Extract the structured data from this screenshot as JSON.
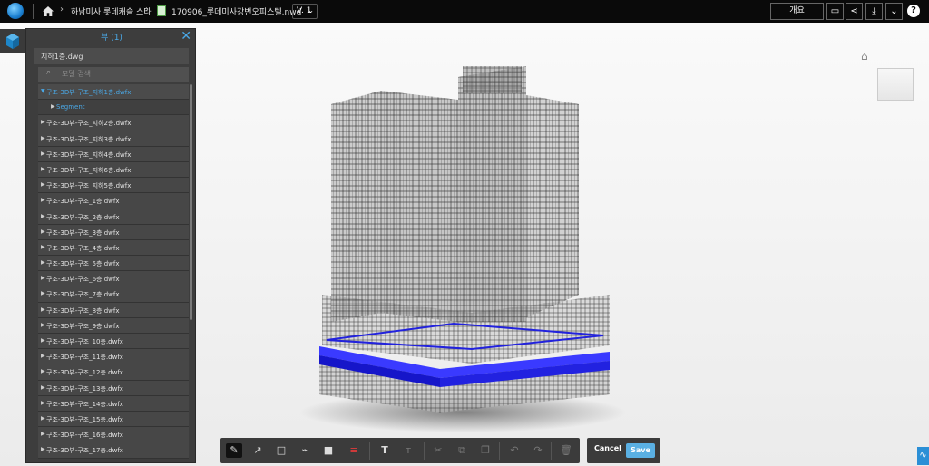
{
  "header": {
    "breadcrumb_project": "하남미사 롯데캐슬 스타",
    "file_name": "170906_롯데미사강변오피스텔.nwd",
    "version": "V. 1",
    "overview_label": "개요",
    "help_label": "?"
  },
  "panel": {
    "title": "뷰 (1)",
    "file_label": "지하1층.dwg",
    "search_placeholder": "모델 검색",
    "tree": [
      {
        "label": "구조-3D뷰-구조_지하1층.dwfx",
        "state": "expanded",
        "level": 0
      },
      {
        "label": "Segment",
        "state": "collapsed",
        "level": 1
      },
      {
        "label": "구조-3D뷰-구조_지하2층.dwfx",
        "state": "collapsed",
        "level": 0
      },
      {
        "label": "구조-3D뷰-구조_지하3층.dwfx",
        "state": "collapsed",
        "level": 0
      },
      {
        "label": "구조-3D뷰-구조_지하4층.dwfx",
        "state": "collapsed",
        "level": 0
      },
      {
        "label": "구조-3D뷰-구조_지하6층.dwfx",
        "state": "collapsed",
        "level": 0
      },
      {
        "label": "구조-3D뷰-구조_지하5층.dwfx",
        "state": "collapsed",
        "level": 0
      },
      {
        "label": "구조-3D뷰-구조_1층.dwfx",
        "state": "collapsed",
        "level": 0
      },
      {
        "label": "구조-3D뷰-구조_2층.dwfx",
        "state": "collapsed",
        "level": 0
      },
      {
        "label": "구조-3D뷰-구조_3층.dwfx",
        "state": "collapsed",
        "level": 0
      },
      {
        "label": "구조-3D뷰-구조_4층.dwfx",
        "state": "collapsed",
        "level": 0
      },
      {
        "label": "구조-3D뷰-구조_5층.dwfx",
        "state": "collapsed",
        "level": 0
      },
      {
        "label": "구조-3D뷰-구조_6층.dwfx",
        "state": "collapsed",
        "level": 0
      },
      {
        "label": "구조-3D뷰-구조_7층.dwfx",
        "state": "collapsed",
        "level": 0
      },
      {
        "label": "구조-3D뷰-구조_8층.dwfx",
        "state": "collapsed",
        "level": 0
      },
      {
        "label": "구조-3D뷰-구조_9층.dwfx",
        "state": "collapsed",
        "level": 0
      },
      {
        "label": "구조-3D뷰-구조_10층.dwfx",
        "state": "collapsed",
        "level": 0
      },
      {
        "label": "구조-3D뷰-구조_11층.dwfx",
        "state": "collapsed",
        "level": 0
      },
      {
        "label": "구조-3D뷰-구조_12층.dwfx",
        "state": "collapsed",
        "level": 0
      },
      {
        "label": "구조-3D뷰-구조_13층.dwfx",
        "state": "collapsed",
        "level": 0
      },
      {
        "label": "구조-3D뷰-구조_14층.dwfx",
        "state": "collapsed",
        "level": 0
      },
      {
        "label": "구조-3D뷰-구조_15층.dwfx",
        "state": "collapsed",
        "level": 0
      },
      {
        "label": "구조-3D뷰-구조_16층.dwfx",
        "state": "collapsed",
        "level": 0
      },
      {
        "label": "구조-3D뷰-구조_17층.dwfx",
        "state": "collapsed",
        "level": 0
      }
    ]
  },
  "markup_toolbar": {
    "tools": [
      "pen-icon",
      "arrow-icon",
      "rectangle-icon",
      "polyline-icon",
      "fill-color-icon",
      "stroke-width-icon",
      "text-icon",
      "font-size-icon",
      "cut-icon",
      "copy-icon",
      "paste-icon",
      "undo-icon",
      "redo-icon",
      "delete-icon"
    ],
    "cancel_label": "Cancel",
    "save_label": "Save"
  },
  "colors": {
    "accent": "#4aa8e6",
    "highlight_floor": "#1a1aff",
    "save_button": "#5ab0e3"
  }
}
